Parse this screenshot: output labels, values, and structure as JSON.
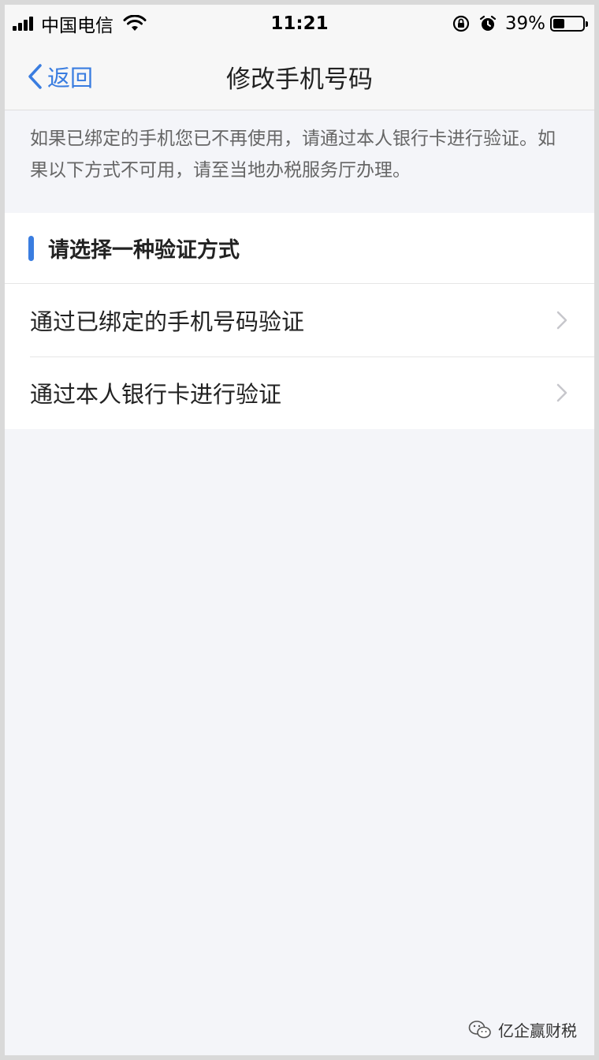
{
  "status_bar": {
    "carrier": "中国电信",
    "time": "11:21",
    "battery_percent": "39%",
    "battery_level": 0.39
  },
  "nav": {
    "back_label": "返回",
    "title": "修改手机号码"
  },
  "notice": {
    "text": "如果已绑定的手机您已不再使用，请通过本人银行卡进行验证。如果以下方式不可用，请至当地办税服务厅办理。"
  },
  "section": {
    "title": "请选择一种验证方式",
    "accent_color": "#3a7de0",
    "options": [
      {
        "label": "通过已绑定的手机号码验证"
      },
      {
        "label": "通过本人银行卡进行验证"
      }
    ]
  },
  "watermark": {
    "text": "亿企赢财税"
  },
  "icons": [
    "signal-icon",
    "wifi-icon",
    "rotation-lock-icon",
    "alarm-icon",
    "battery-icon",
    "back-chevron-icon",
    "chevron-right-icon",
    "wechat-icon"
  ]
}
